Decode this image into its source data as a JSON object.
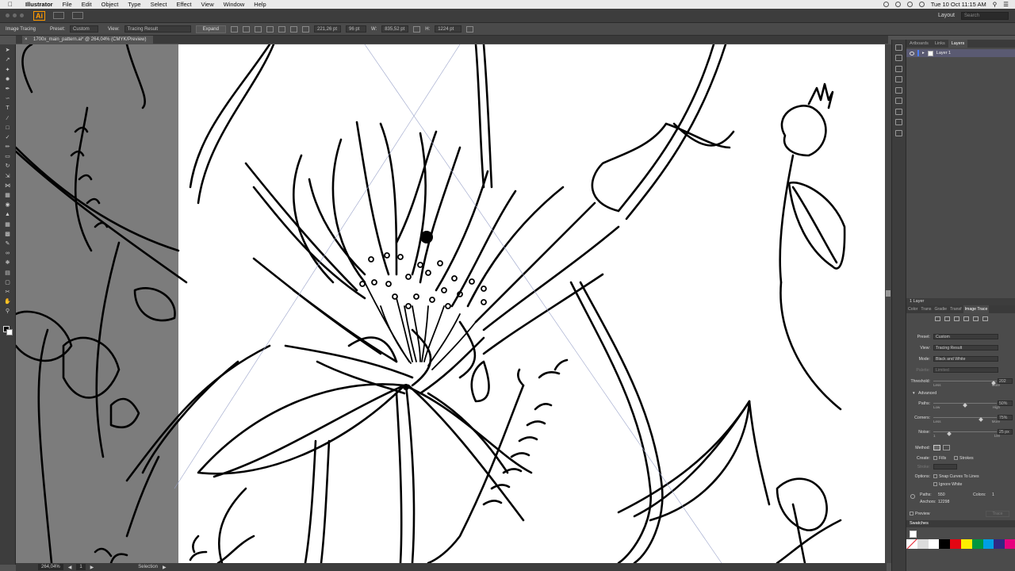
{
  "menubar": {
    "app": "Illustrator",
    "items": [
      "File",
      "Edit",
      "Object",
      "Type",
      "Select",
      "Effect",
      "View",
      "Window",
      "Help"
    ],
    "clock": "Tue 10 Oct  11:15 AM"
  },
  "appbar": {
    "logo": "Ai",
    "workspace": "Layout",
    "search_placeholder": "Search"
  },
  "control": {
    "title": "Image Tracing",
    "preset_label": "Preset:",
    "preset_value": "Custom",
    "view_label": "View:",
    "view_value": "Tracing Result",
    "expand_label": "Expand",
    "x_value": "221,26 pt",
    "y_value": "96 pt",
    "w_label": "W:",
    "w_value": "835,52 pt",
    "h_label": "H:",
    "h_value": "1224 pt"
  },
  "document": {
    "tab_title": "1700x_main_pattern.ai* @ 264,04% (CMYK/Preview)"
  },
  "status": {
    "zoom": "264,04%",
    "page": "1",
    "tool": "Selection"
  },
  "layers_panel": {
    "tabs": [
      "Artboards",
      "Links",
      "Layers"
    ],
    "active_tab": "Layers",
    "layer_name": "Layer 1",
    "footer": "1 Layer"
  },
  "trace_panel": {
    "tabs": [
      "Color",
      "Trans",
      "Gradie",
      "Transf",
      "Image Trace"
    ],
    "active_tab": "Image Trace",
    "preset_label": "Preset:",
    "preset_value": "Custom",
    "view_label": "View:",
    "view_value": "Tracing Result",
    "mode_label": "Mode:",
    "mode_value": "Black and White",
    "palette_label": "Palette:",
    "palette_value": "Limited",
    "threshold_label": "Threshold:",
    "threshold_value": "202",
    "threshold_left": "Less",
    "threshold_right": "More",
    "advanced_label": "Advanced",
    "paths_label": "Paths:",
    "paths_value": "50%",
    "paths_left": "Low",
    "paths_right": "High",
    "corners_label": "Corners:",
    "corners_value": "75%",
    "corners_left": "Less",
    "corners_right": "More",
    "noise_label": "Noise:",
    "noise_value": "25 px",
    "noise_left": "1",
    "noise_right": "100",
    "method_label": "Method:",
    "create_label": "Create:",
    "create_fills": "Fills",
    "create_strokes": "Strokes",
    "stroke_label": "Stroke:",
    "options_label": "Options:",
    "option_snap": "Snap Curves To Lines",
    "option_ignore": "Ignore White",
    "paths_count_label": "Paths:",
    "paths_count": "550",
    "colors_count_label": "Colors:",
    "colors_count": "1",
    "anchors_label": "Anchors:",
    "anchors_count": "12298",
    "preview_label": "Preview",
    "trace_button": "Trace"
  },
  "swatches": {
    "title": "Swatches",
    "colors": [
      "#ffffff",
      "#000000",
      "#e30613",
      "#ffed00",
      "#009640",
      "#009fe3",
      "#312783",
      "#e6007e"
    ]
  }
}
